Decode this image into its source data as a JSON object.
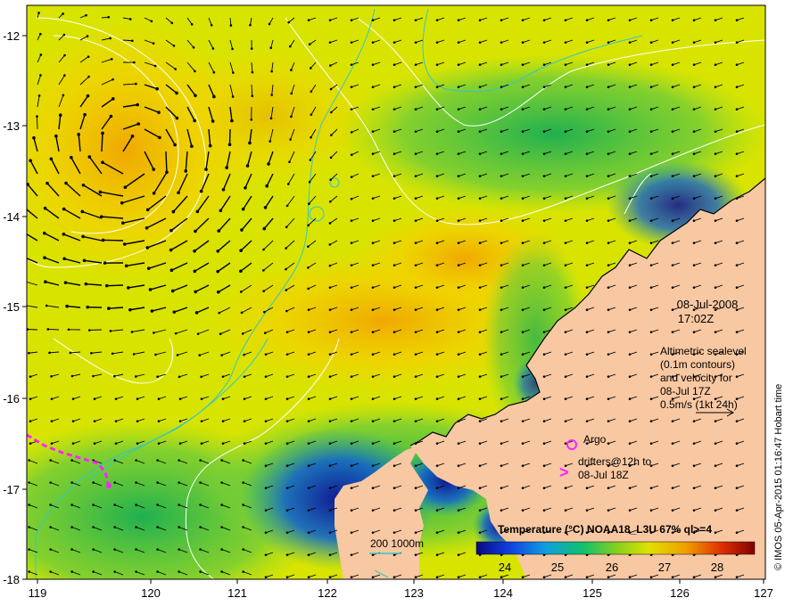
{
  "map": {
    "axes": {
      "lon_ticks": [
        "119",
        "120",
        "121",
        "122",
        "123",
        "124",
        "125",
        "126",
        "127"
      ],
      "lat_ticks": [
        "-12",
        "-13",
        "-14",
        "-15",
        "-16",
        "-17",
        "-18"
      ]
    },
    "date": "08-Jul-2008",
    "time": "17:02Z",
    "info_lines": [
      "Altimetric sealevel",
      "(0.1m contours)",
      "and velocity for",
      "08-Jul 17Z",
      "0.5m/s (1kt 24h)"
    ],
    "argo_label": "Argo",
    "drifters_line1": "drifters@12h to",
    "drifters_line2": "08-Jul 18Z",
    "bathy_label": "200  1000m",
    "colorbar": {
      "title": "Temperature (°C) NOAA18_L3U 67% ql>=4",
      "ticks": [
        "24",
        "25",
        "26",
        "27",
        "28"
      ]
    },
    "credit": "© IMOS 05-Apr-2015 01:16:47 Hobart time",
    "colors": {
      "land": "#f8c8a2",
      "sst_warm": "#f0c000",
      "sst_mid": "#c8e000",
      "sst_cool": "#30c060",
      "sst_cold": "#1018a0",
      "contour": "#ffffff",
      "bathymetry": "#30c8c8",
      "drifter": "#ff22ff"
    }
  }
}
